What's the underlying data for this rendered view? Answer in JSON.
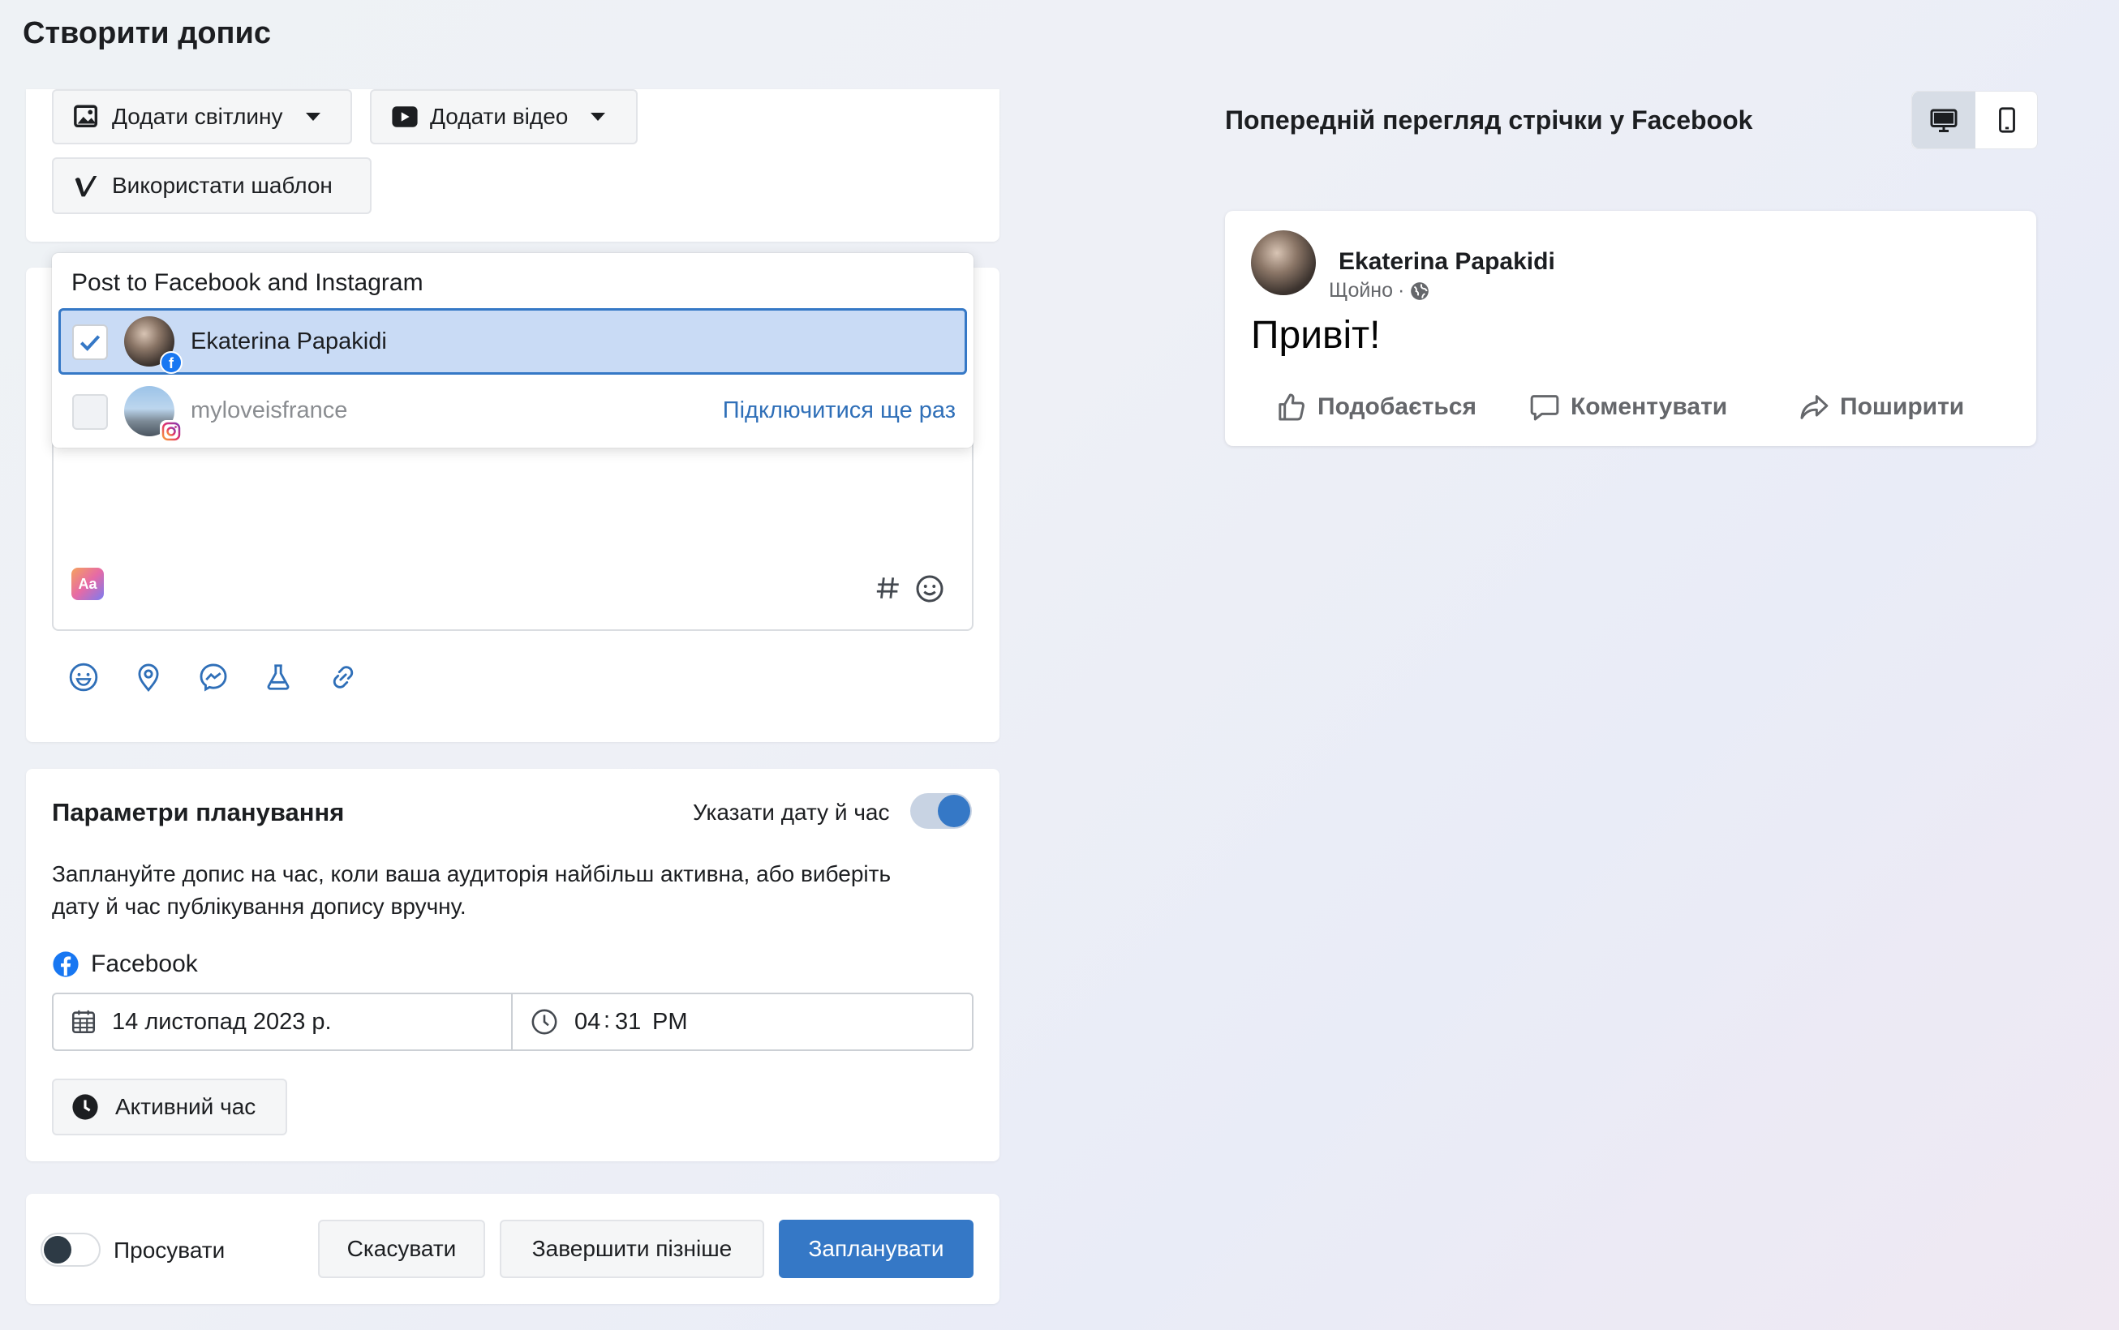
{
  "page": {
    "title": "Створити допис"
  },
  "media_buttons": {
    "add_photo": "Додати світлину",
    "add_video": "Додати відео",
    "use_template": "Використати шаблон"
  },
  "post_to": {
    "header": "Post to Facebook and Instagram",
    "accounts": [
      {
        "name": "Ekaterina Papakidi",
        "network": "facebook",
        "checked": true,
        "action": ""
      },
      {
        "name": "myloveisfrance",
        "network": "instagram",
        "checked": false,
        "action": "Підключитися ще раз"
      }
    ]
  },
  "composer_icons": [
    "text-format-icon",
    "hashtag-icon",
    "emoji-icon",
    "feeling-icon",
    "location-icon",
    "messenger-icon",
    "lab-icon",
    "link-icon"
  ],
  "scheduling": {
    "title": "Параметри планування",
    "toggle_label": "Указати дату й час",
    "toggle_on": true,
    "description_line1": "Заплануйте допис на час, коли ваша аудиторія найбільш активна, або виберіть",
    "description_line2": "дату й час публікування допису вручну.",
    "network": "Facebook",
    "date": "14 листопад 2023 р.",
    "time_hour": "04",
    "time_minute": "31",
    "time_period": "PM",
    "active_time_button": "Активний час"
  },
  "footer": {
    "boost_label": "Просувати",
    "boost_on": false,
    "cancel": "Скасувати",
    "finish_later": "Завершити пізніше",
    "schedule": "Запланувати"
  },
  "preview": {
    "title": "Попередній перегляд стрічки у Facebook",
    "author": "Ekaterina Papakidi",
    "timestamp": "Щойно",
    "separator": "·",
    "text": "Привіт!",
    "like": "Подобається",
    "comment": "Коментувати",
    "share": "Поширити"
  },
  "colors": {
    "primary": "#3578c6",
    "selected_row_bg": "#c9dbf5",
    "link": "#2f6fb8"
  }
}
